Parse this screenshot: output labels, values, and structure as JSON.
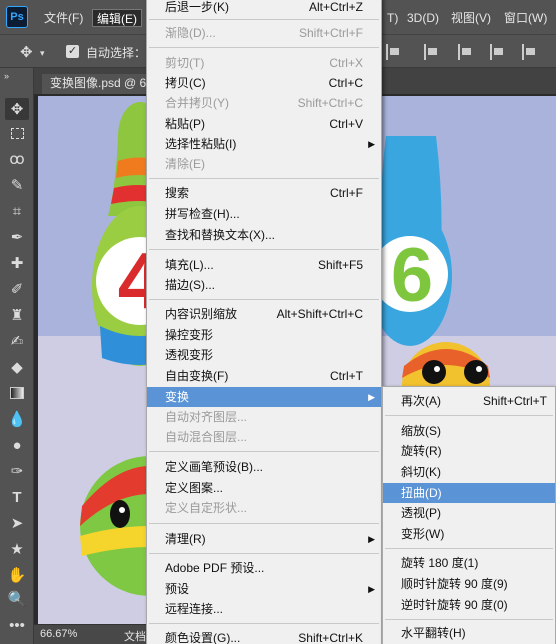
{
  "app": {
    "logo": "Ps"
  },
  "menubar": {
    "file": "文件(F)",
    "edit": "编辑(E)",
    "type_partial": "T)",
    "three_d": "3D(D)",
    "view": "视图(V)",
    "window": "窗口(W)"
  },
  "options": {
    "auto_select": "自动选择："
  },
  "document": {
    "tab_label": "变换图像.psd @ 6",
    "zoom": "66.67%",
    "status_partial": "文档"
  },
  "edit_menu": {
    "items": [
      {
        "label": "后退一步(K)",
        "shortcut": "Alt+Ctrl+Z",
        "disabled": false
      },
      {
        "label": "渐隐(D)...",
        "shortcut": "Shift+Ctrl+F",
        "disabled": true
      },
      {
        "label": "剪切(T)",
        "shortcut": "Ctrl+X",
        "disabled": true
      },
      {
        "label": "拷贝(C)",
        "shortcut": "Ctrl+C",
        "disabled": false
      },
      {
        "label": "合并拷贝(Y)",
        "shortcut": "Shift+Ctrl+C",
        "disabled": true
      },
      {
        "label": "粘贴(P)",
        "shortcut": "Ctrl+V",
        "disabled": false
      },
      {
        "label": "选择性粘贴(I)",
        "shortcut": "",
        "disabled": false
      },
      {
        "label": "清除(E)",
        "shortcut": "",
        "disabled": true
      },
      {
        "label": "搜索",
        "shortcut": "Ctrl+F",
        "disabled": false
      },
      {
        "label": "拼写检查(H)...",
        "shortcut": "",
        "disabled": false
      },
      {
        "label": "查找和替换文本(X)...",
        "shortcut": "",
        "disabled": false
      },
      {
        "label": "填充(L)...",
        "shortcut": "Shift+F5",
        "disabled": false
      },
      {
        "label": "描边(S)...",
        "shortcut": "",
        "disabled": false
      },
      {
        "label": "内容识别缩放",
        "shortcut": "Alt+Shift+Ctrl+C",
        "disabled": false
      },
      {
        "label": "操控变形",
        "shortcut": "",
        "disabled": false
      },
      {
        "label": "透视变形",
        "shortcut": "",
        "disabled": false
      },
      {
        "label": "自由变换(F)",
        "shortcut": "Ctrl+T",
        "disabled": false
      },
      {
        "label": "变换",
        "shortcut": "",
        "disabled": false
      },
      {
        "label": "自动对齐图层...",
        "shortcut": "",
        "disabled": true
      },
      {
        "label": "自动混合图层...",
        "shortcut": "",
        "disabled": true
      },
      {
        "label": "定义画笔预设(B)...",
        "shortcut": "",
        "disabled": false
      },
      {
        "label": "定义图案...",
        "shortcut": "",
        "disabled": false
      },
      {
        "label": "定义自定形状...",
        "shortcut": "",
        "disabled": true
      },
      {
        "label": "清理(R)",
        "shortcut": "",
        "disabled": false
      },
      {
        "label": "Adobe PDF 预设...",
        "shortcut": "",
        "disabled": false
      },
      {
        "label": "预设",
        "shortcut": "",
        "disabled": false
      },
      {
        "label": "远程连接...",
        "shortcut": "",
        "disabled": false
      },
      {
        "label": "颜色设置(G)...",
        "shortcut": "Shift+Ctrl+K",
        "disabled": false
      }
    ]
  },
  "transform_submenu": {
    "items": [
      {
        "label": "再次(A)",
        "shortcut": "Shift+Ctrl+T"
      },
      {
        "label": "缩放(S)",
        "shortcut": ""
      },
      {
        "label": "旋转(R)",
        "shortcut": ""
      },
      {
        "label": "斜切(K)",
        "shortcut": ""
      },
      {
        "label": "扭曲(D)",
        "shortcut": ""
      },
      {
        "label": "透视(P)",
        "shortcut": ""
      },
      {
        "label": "变形(W)",
        "shortcut": ""
      },
      {
        "label": "旋转 180 度(1)",
        "shortcut": ""
      },
      {
        "label": "顺时针旋转 90 度(9)",
        "shortcut": ""
      },
      {
        "label": "逆时针旋转 90 度(0)",
        "shortcut": ""
      },
      {
        "label": "水平翻转(H)",
        "shortcut": ""
      }
    ]
  },
  "icons": {
    "move": "move-icon",
    "marquee": "marquee-icon",
    "lasso": "lasso-icon",
    "quick_select": "quick-select-icon",
    "crop": "crop-icon",
    "eyedropper": "eyedropper-icon",
    "healing": "healing-icon",
    "brush": "brush-icon",
    "stamp": "stamp-icon",
    "history_brush": "history-brush-icon",
    "eraser": "eraser-icon",
    "gradient": "gradient-icon",
    "blur": "blur-icon",
    "dodge": "dodge-icon",
    "pen": "pen-icon",
    "type": "type-icon",
    "path_select": "path-select-icon",
    "shape": "shape-icon",
    "hand": "hand-icon",
    "zoom": "zoom-icon",
    "more": "more-tools-icon"
  },
  "colors": {
    "menu_bg": "#f0f0f0",
    "menu_highlight": "#5b94d6",
    "chrome": "#535353",
    "canvas_bg": "#aab3dc"
  }
}
